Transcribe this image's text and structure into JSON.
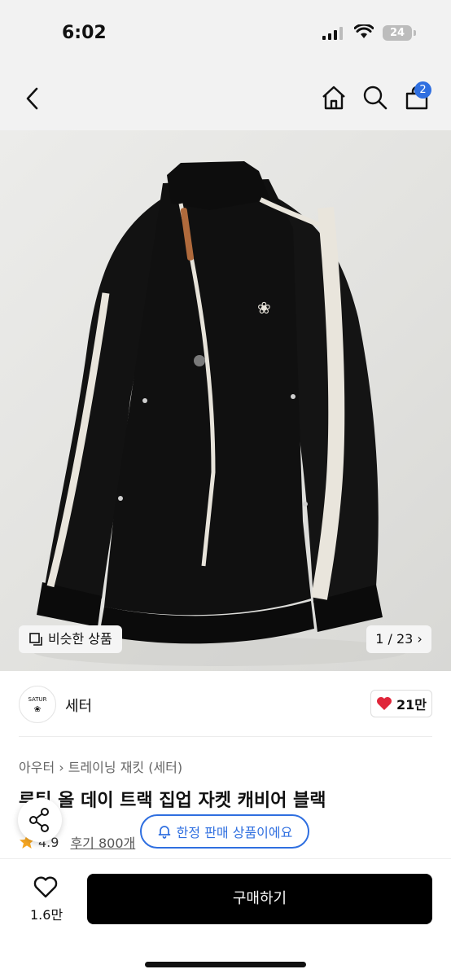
{
  "status_bar": {
    "time": "6:02",
    "battery": "24"
  },
  "nav": {
    "cart_count": "2",
    "icons": [
      "back-icon",
      "home-icon",
      "search-icon",
      "cart-icon"
    ]
  },
  "gallery": {
    "similar_label": "비슷한 상품",
    "pager": "1 / 23 ›"
  },
  "brand": {
    "name": "세터",
    "logo_text": "SATUR",
    "likes": "21만"
  },
  "product": {
    "breadcrumb": "아우터 › 트레이닝 재킷 (세터)",
    "title": "루틴 올 데이 트랙 집업 자켓 캐비어 블랙",
    "rating": "4.9",
    "reviews": "후기 800개",
    "limited_label": "한정 판매 상품이에요"
  },
  "bottom_bar": {
    "wish_count": "1.6만",
    "buy_label": "구매하기"
  },
  "colors": {
    "accent": "#2f6fe0",
    "heart": "#e0263a",
    "star": "#f5a623",
    "buy_button": "#000000"
  }
}
